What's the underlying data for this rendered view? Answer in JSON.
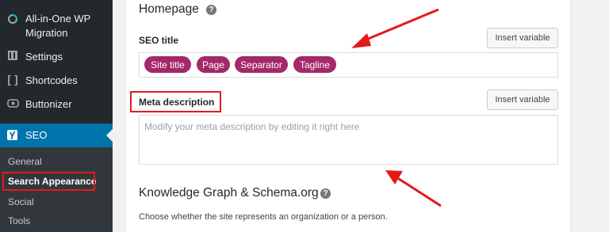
{
  "sidebar": {
    "items": [
      {
        "label_line1": "All-in-One WP",
        "label_line2": "Migration",
        "icon": "migration-icon"
      },
      {
        "label": "Settings",
        "icon": "settings-icon"
      },
      {
        "label": "Shortcodes",
        "icon": "shortcodes-icon"
      },
      {
        "label": "Buttonizer",
        "icon": "buttonizer-icon"
      }
    ],
    "seo": {
      "label": "SEO",
      "icon": "yoast-icon"
    },
    "submenu": [
      "General",
      "Search Appearance",
      "Social",
      "Tools"
    ],
    "submenu_current": "Search Appearance"
  },
  "main": {
    "homepage_heading": "Homepage",
    "help_glyph": "?",
    "seo_title_label": "SEO title",
    "insert_variable_label": "Insert variable",
    "seo_title_pills": [
      "Site title",
      "Page",
      "Separator",
      "Tagline"
    ],
    "meta_label": "Meta description",
    "meta_placeholder": "Modify your meta description by editing it right here",
    "kg_heading": "Knowledge Graph & Schema.org",
    "kg_description": "Choose whether the site represents an organization or a person."
  },
  "colors": {
    "sidebar_bg": "#23282d",
    "active_menu": "#0073aa",
    "pill": "#a4286a",
    "annotation": "#e41a1a"
  }
}
